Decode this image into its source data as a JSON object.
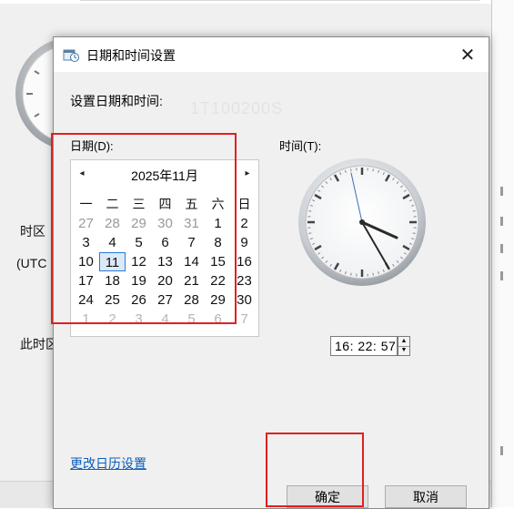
{
  "background": {
    "label_timezone": "时区",
    "label_utc": "(UTC",
    "label_now": "此时区"
  },
  "dialog": {
    "title": "日期和时间设置",
    "close_glyph": "✕",
    "instruction": "设置日期和时间:",
    "ghost_text": "1T100200S",
    "date_label": "日期(D):",
    "time_label": "时间(T):",
    "calendar": {
      "prev_glyph": "◂",
      "next_glyph": "▸",
      "month_title": "2025年11月",
      "weekdays": [
        "一",
        "二",
        "三",
        "四",
        "五",
        "六",
        "日"
      ],
      "weeks": [
        [
          "27",
          "28",
          "29",
          "30",
          "31",
          "1",
          "2"
        ],
        [
          "3",
          "4",
          "5",
          "6",
          "7",
          "8",
          "9"
        ],
        [
          "10",
          "11",
          "12",
          "13",
          "14",
          "15",
          "16"
        ],
        [
          "17",
          "18",
          "19",
          "20",
          "21",
          "22",
          "23"
        ],
        [
          "24",
          "25",
          "26",
          "27",
          "28",
          "29",
          "30"
        ],
        [
          "1",
          "2",
          "3",
          "4",
          "5",
          "6",
          "7"
        ]
      ],
      "selected_day": "11"
    },
    "time_value": "16: 22: 57",
    "spin_up_glyph": "▲",
    "spin_down_glyph": "▼",
    "calendar_link": "更改日历设置",
    "ok_label": "确定",
    "cancel_label": "取消"
  },
  "colors": {
    "annotation_red": "#e02020",
    "link_blue": "#0b5fbd",
    "selection_blue": "#2b79d9"
  }
}
